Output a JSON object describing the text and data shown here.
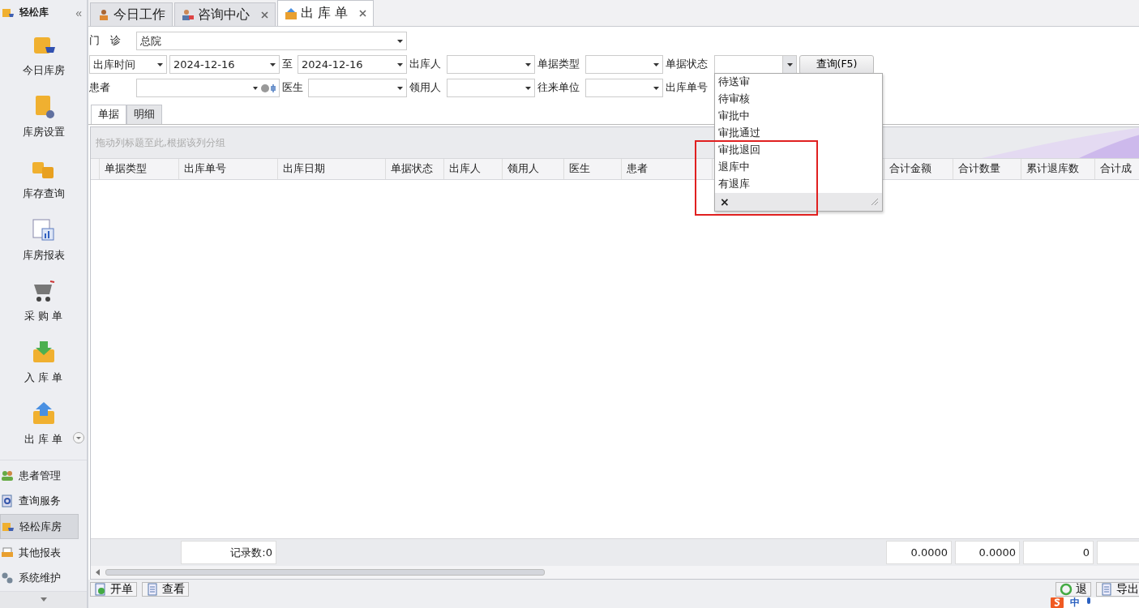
{
  "sidebar": {
    "title": "轻松库",
    "collapse": "«",
    "big_items": [
      {
        "label": "今日库房",
        "expander": false
      },
      {
        "label": "库房设置",
        "expander": false
      },
      {
        "label": "库存查询",
        "expander": false
      },
      {
        "label": "库房报表",
        "expander": false
      },
      {
        "label": "采 购 单",
        "expander": false
      },
      {
        "label": "入 库 单",
        "expander": false
      },
      {
        "label": "出 库 单",
        "expander": true
      }
    ],
    "nav_items": [
      {
        "label": "患者管理",
        "selected": false
      },
      {
        "label": "查询服务",
        "selected": false
      },
      {
        "label": "轻松库房",
        "selected": true
      },
      {
        "label": "其他报表",
        "selected": false
      },
      {
        "label": "系统维护",
        "selected": false
      }
    ]
  },
  "tabs": [
    {
      "label": "今日工作",
      "selected": false,
      "closable": false
    },
    {
      "label": "咨询中心",
      "selected": false,
      "closable": true
    },
    {
      "label": "出 库 单",
      "selected": true,
      "closable": true
    }
  ],
  "filter_rows": [
    [
      {
        "kind": "label",
        "text": "门　诊"
      },
      {
        "kind": "combo",
        "value": "总院"
      }
    ],
    [
      {
        "kind": "combo",
        "value": "出库时间"
      },
      {
        "kind": "combo",
        "value": "2024-12-16"
      },
      {
        "kind": "label",
        "text": "至"
      },
      {
        "kind": "combo",
        "value": "2024-12-16"
      },
      {
        "kind": "label",
        "text": "出库人"
      },
      {
        "kind": "combo"
      },
      {
        "kind": "label",
        "text": "单据类型"
      },
      {
        "kind": "combo"
      },
      {
        "kind": "label",
        "text": "单据状态"
      },
      {
        "kind": "combo",
        "open": true
      },
      {
        "kind": "button",
        "text": "查询(F5)"
      }
    ],
    [
      {
        "kind": "label",
        "text": "患者"
      },
      {
        "kind": "combo",
        "clearable": true
      },
      {
        "kind": "label",
        "text": "医生"
      },
      {
        "kind": "combo"
      },
      {
        "kind": "label",
        "text": "领用人"
      },
      {
        "kind": "combo"
      },
      {
        "kind": "label",
        "text": "往来单位"
      },
      {
        "kind": "combo"
      },
      {
        "kind": "label",
        "text": "出库单号"
      }
    ]
  ],
  "status_dropdown": {
    "items": [
      "待送审",
      "待审核",
      "审批中",
      "审批通过",
      "审批退回",
      "退库中",
      "有退库"
    ],
    "clear": "×"
  },
  "inner_tabs": [
    {
      "label": "单据",
      "selected": true
    },
    {
      "label": "明细",
      "selected": false
    }
  ],
  "grid": {
    "group_hint": "拖动列标题至此,根据该列分组",
    "columns": [
      "单据类型",
      "出库单号",
      "出库日期",
      "单据状态",
      "出库人",
      "领用人",
      "医生",
      "患者",
      null,
      "合计金额",
      "合计数量",
      "累计退库数",
      "合计成"
    ],
    "footer": [
      "记录数:0",
      "0.0000",
      "0.0000",
      "0"
    ]
  },
  "bottom_buttons": [
    {
      "label": "开单"
    },
    {
      "label": "查看"
    },
    {
      "label": "退"
    },
    {
      "label": "导出"
    }
  ],
  "ime_bar": {
    "text": "中"
  }
}
